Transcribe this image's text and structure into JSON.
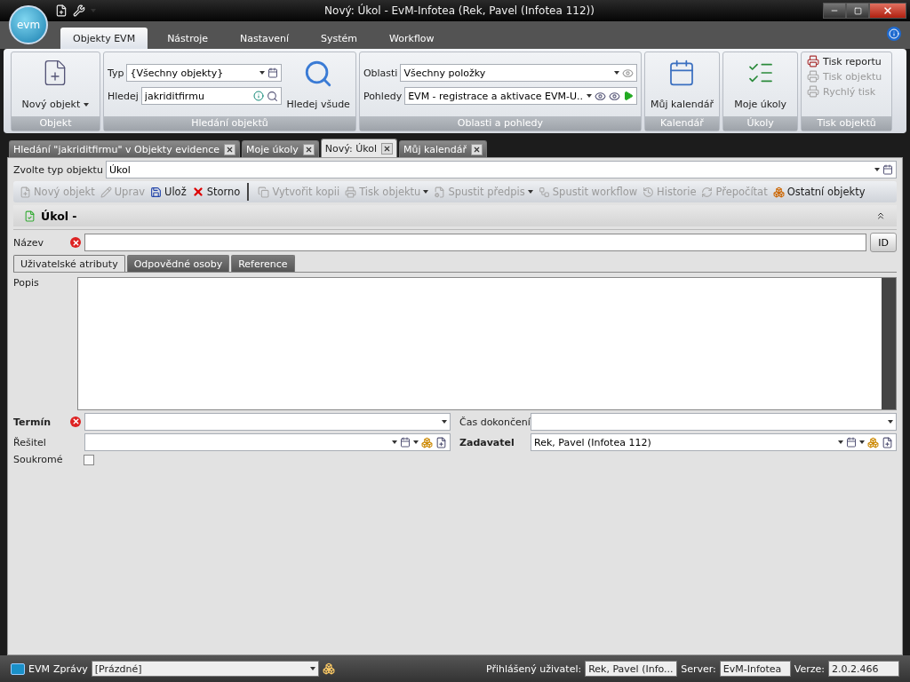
{
  "window": {
    "title": "Nový: Úkol - EvM-Infotea (Rek, Pavel (Infotea 112))",
    "logo": "evm"
  },
  "ribbon_tabs": [
    {
      "label": "Objekty EVM",
      "selected": true
    },
    {
      "label": "Nástroje",
      "selected": false
    },
    {
      "label": "Nastavení",
      "selected": false
    },
    {
      "label": "Systém",
      "selected": false
    },
    {
      "label": "Workflow",
      "selected": false
    }
  ],
  "ribbon": {
    "objekt": {
      "button": "Nový objekt",
      "caption": "Objekt"
    },
    "search": {
      "typ_label": "Typ",
      "typ_value": "{Všechny objekty}",
      "hledej_label": "Hledej",
      "hledej_value": "jakriditfirmu",
      "search_all": "Hledej všude",
      "caption": "Hledání objektů"
    },
    "areas": {
      "oblasti_label": "Oblasti",
      "oblasti_value": "Všechny položky",
      "pohledy_label": "Pohledy",
      "pohledy_value": "EVM - registrace a aktivace EVM-U...",
      "caption": "Oblasti a pohledy"
    },
    "calendar": {
      "button": "Můj kalendář",
      "caption": "Kalendář"
    },
    "tasks": {
      "button": "Moje úkoly",
      "caption": "Úkoly"
    },
    "print": {
      "caption": "Tisk objektů",
      "items": [
        {
          "label": "Tisk reportu",
          "disabled": false
        },
        {
          "label": "Tisk objektu",
          "disabled": true
        },
        {
          "label": "Rychlý tisk",
          "disabled": true
        }
      ]
    }
  },
  "doc_tabs": [
    {
      "label": "Hledání \"jakriditfirmu\" v Objekty evidence",
      "selected": false
    },
    {
      "label": "Moje úkoly",
      "selected": false
    },
    {
      "label": "Nový: Úkol",
      "selected": true
    },
    {
      "label": "Můj kalendář",
      "selected": false
    }
  ],
  "object_type": {
    "label": "Zvolte typ objektu",
    "value": "Úkol"
  },
  "toolbar_left": [
    {
      "label": "Nový objekt",
      "disabled": true,
      "has_menu": false
    },
    {
      "label": "Uprav",
      "disabled": true,
      "has_menu": false
    },
    {
      "label": "Ulož",
      "disabled": false,
      "has_menu": false
    },
    {
      "label": "Storno",
      "disabled": false,
      "has_menu": false
    }
  ],
  "toolbar_right": [
    {
      "label": "Vytvořit kopii",
      "disabled": true,
      "has_menu": false
    },
    {
      "label": "Tisk objektu",
      "disabled": true,
      "has_menu": true
    },
    {
      "label": "Spustit předpis",
      "disabled": true,
      "has_menu": true
    },
    {
      "label": "Spustit workflow",
      "disabled": true,
      "has_menu": false
    },
    {
      "label": "Historie",
      "disabled": true,
      "has_menu": false
    },
    {
      "label": "Přepočítat",
      "disabled": true,
      "has_menu": false
    },
    {
      "label": "Ostatní objekty",
      "disabled": false,
      "has_menu": false
    }
  ],
  "form": {
    "header": "Úkol -",
    "name_field": {
      "label": "Název",
      "invalid": true,
      "button": "ID"
    },
    "tabs": [
      {
        "label": "Uživatelské atributy",
        "selected": true
      },
      {
        "label": "Odpovědné osoby",
        "selected": false
      },
      {
        "label": "Reference",
        "selected": false
      }
    ],
    "description": {
      "label": "Popis"
    },
    "termin": {
      "label": "Termín",
      "required": true,
      "invalid": true
    },
    "completion": {
      "label": "Čas dokončení",
      "required": false
    },
    "resitel": {
      "label": "Řešitel",
      "required": false
    },
    "zadavatel": {
      "label": "Zadavatel",
      "required": true,
      "value": "Rek, Pavel (Infotea 112)"
    },
    "private": {
      "label": "Soukromé",
      "checked": false
    }
  },
  "status_bar": {
    "app": "EVM",
    "messages_label": "Zprávy",
    "messages_value": "[Prázdné]",
    "user_label": "Přihlášený uživatel:",
    "user_value": "Rek, Pavel (Info...",
    "server_label": "Server:",
    "server_value": "EvM-Infotea",
    "version_label": "Verze:",
    "version_value": "2.0.2.466"
  }
}
